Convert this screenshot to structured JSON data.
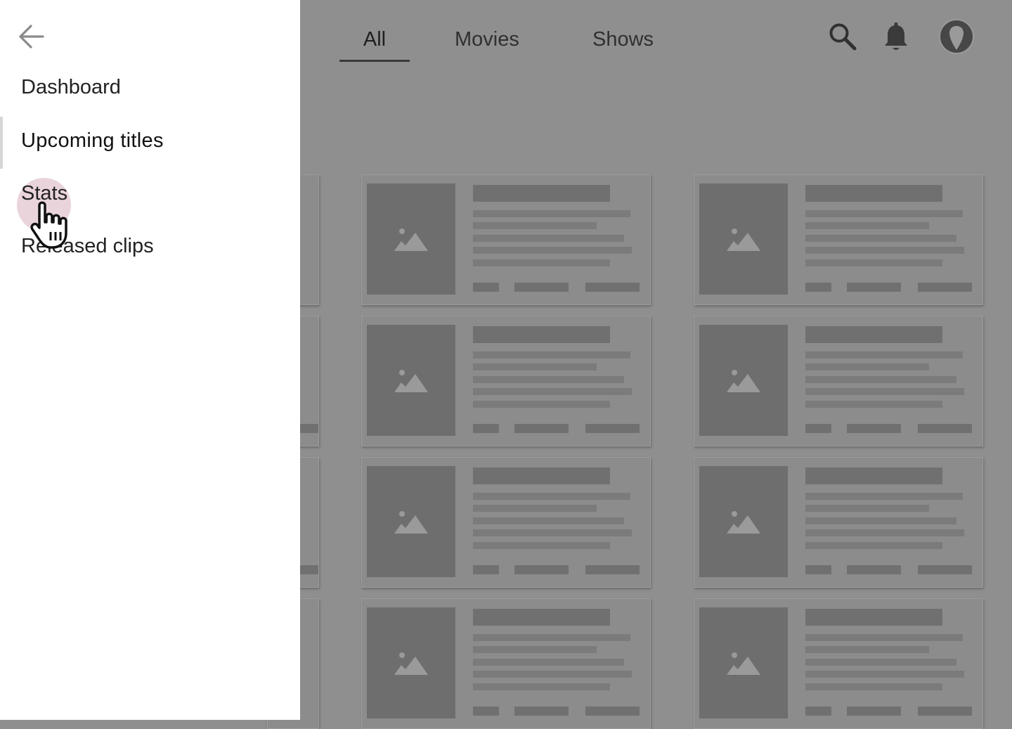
{
  "tabs": [
    {
      "label": "All",
      "active": true
    },
    {
      "label": "Movies",
      "active": false
    },
    {
      "label": "Shows",
      "active": false
    }
  ],
  "header_icons": {
    "search": "search-icon",
    "notifications": "bell-icon",
    "profile": "avatar"
  },
  "drawer": {
    "back_icon": "arrow-left-icon",
    "items": [
      {
        "label": "Dashboard",
        "active": false
      },
      {
        "label": "Upcoming titles",
        "active": true
      },
      {
        "label": "Stats",
        "active": false,
        "pressed": true
      },
      {
        "label": "Released clips",
        "active": false
      }
    ]
  },
  "colors": {
    "scrim": "#8f8f8f",
    "drawer_bg": "#ffffff",
    "touch_ripple": "#d9b0be",
    "placeholder": "#6e6e6e"
  },
  "content_placeholder_cards": 8
}
